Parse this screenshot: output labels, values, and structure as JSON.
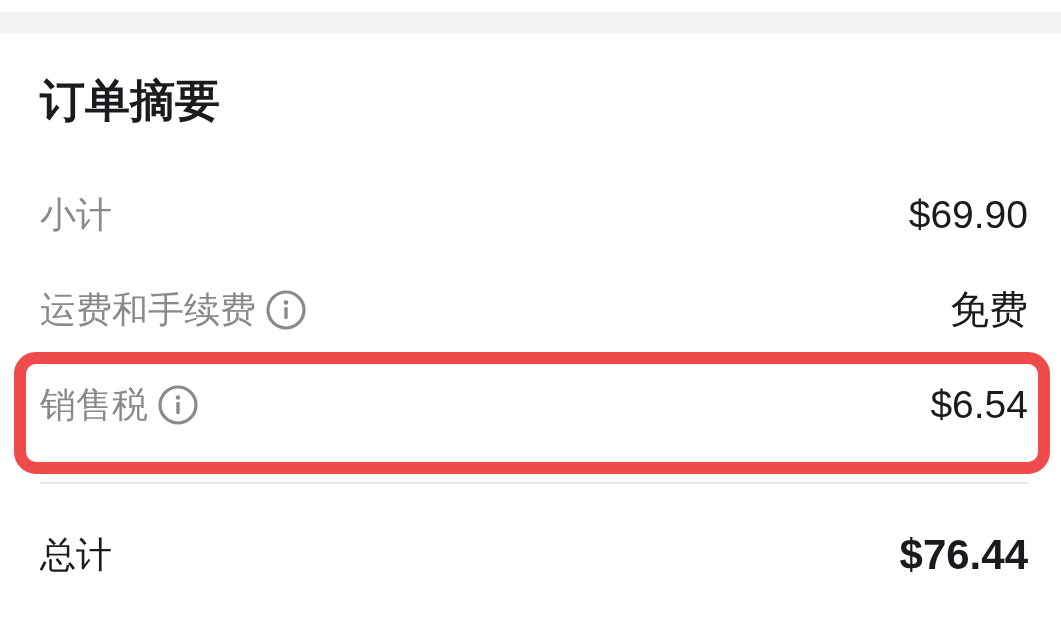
{
  "title": "订单摘要",
  "rows": [
    {
      "label": "小计",
      "info": false,
      "value": "$69.90",
      "highlighted": false
    },
    {
      "label": "运费和手续费",
      "info": true,
      "value": "免费",
      "highlighted": false
    },
    {
      "label": "销售税",
      "info": true,
      "value": "$6.54",
      "highlighted": true
    }
  ],
  "total": {
    "label": "总计",
    "value": "$76.44"
  }
}
